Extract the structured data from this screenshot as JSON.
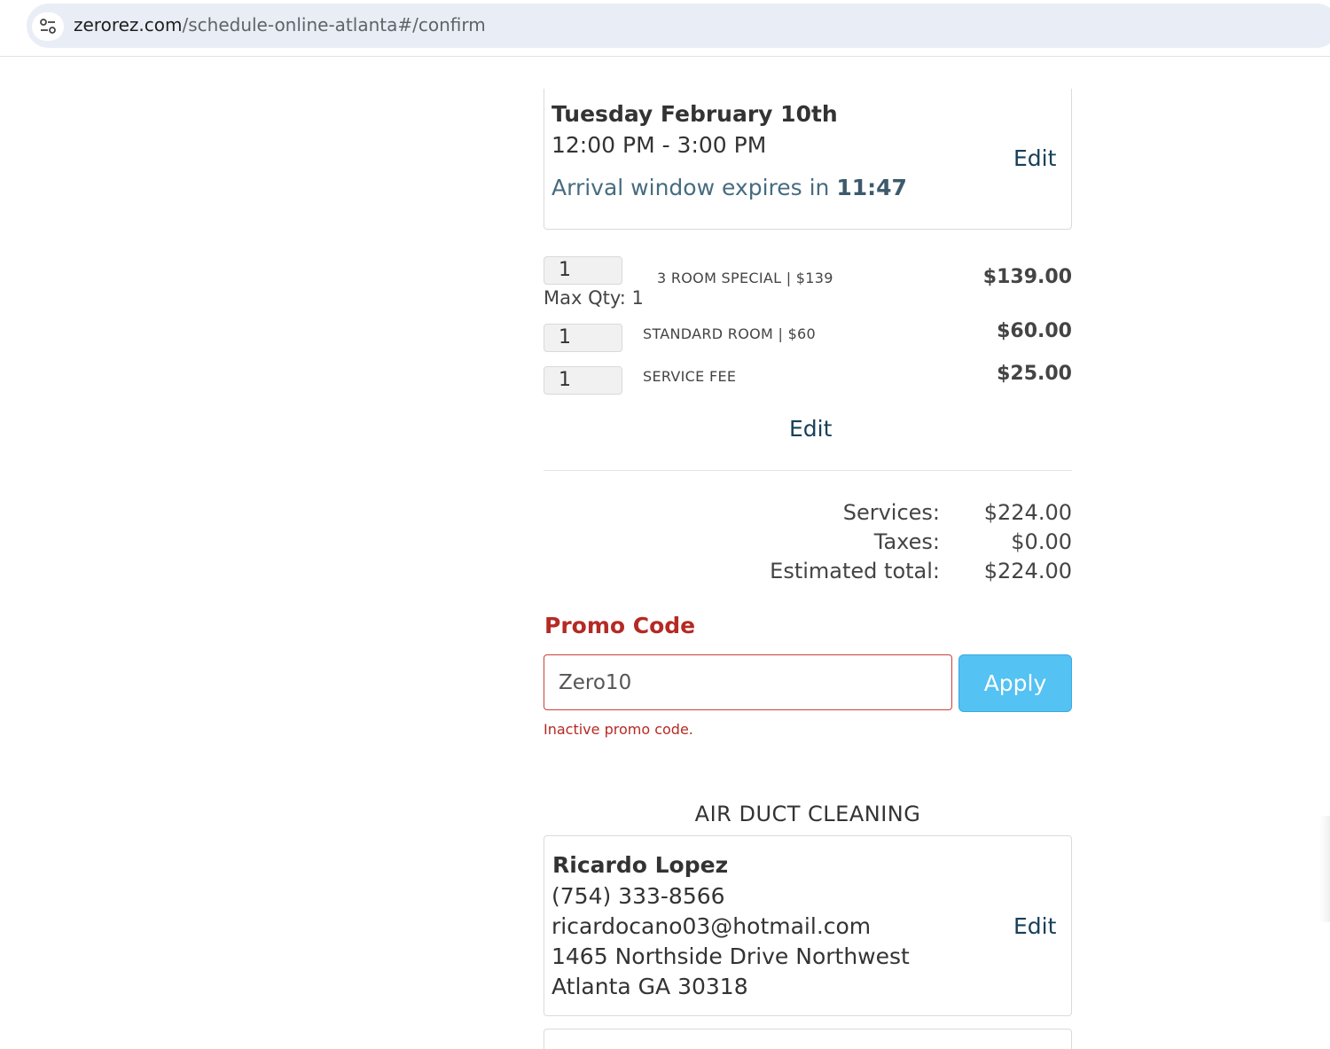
{
  "browser": {
    "url_host": "zerorez.com",
    "url_path": "/schedule-online-atlanta#/confirm",
    "site_icon": "tune-icon"
  },
  "progress": {
    "steps_total": 5,
    "step_color": "#1a8fd6"
  },
  "appointment": {
    "date": "Tuesday February 10th",
    "time_window": "12:00 PM - 3:00 PM",
    "expires_label": "Arrival window expires in ",
    "expires_time": "11:47",
    "edit_label": "Edit"
  },
  "line_items": [
    {
      "qty": "1",
      "name": "3 ROOM SPECIAL  |  $139",
      "price": "$139.00",
      "max_qty": "Max Qty: 1"
    },
    {
      "qty": "1",
      "name": "STANDARD ROOM  |  $60",
      "price": "$60.00"
    },
    {
      "qty": "1",
      "name": "SERVICE FEE",
      "price": "$25.00"
    }
  ],
  "items_edit_label": "Edit",
  "totals": {
    "services_label": "Services:",
    "services_value": "$224.00",
    "taxes_label": "Taxes:",
    "taxes_value": "$0.00",
    "total_label": "Estimated total:",
    "total_value": "$224.00"
  },
  "promo": {
    "title": "Promo Code",
    "value": "Zero10",
    "apply_label": "Apply",
    "error": "Inactive promo code.",
    "error_color": "#b52a24",
    "button_color": "#54c2f2"
  },
  "section_title": "AIR DUCT CLEANING",
  "contact": {
    "name": "Ricardo Lopez",
    "phone": "(754) 333-8566",
    "email": "ricardocano03@hotmail.com",
    "street": "1465 Northside Drive Northwest",
    "city_line": "Atlanta GA 30318",
    "edit_label": "Edit"
  }
}
